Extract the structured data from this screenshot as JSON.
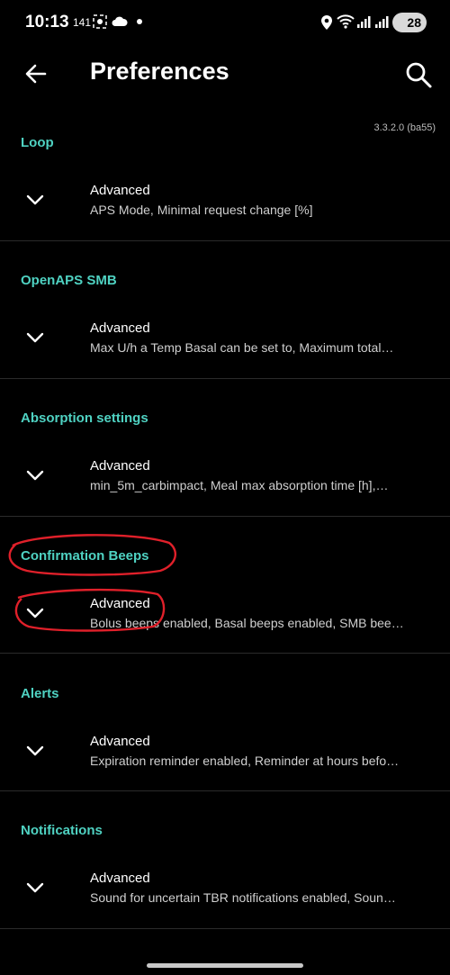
{
  "status_bar": {
    "time": "10:13",
    "small_text": "141",
    "battery": "28"
  },
  "appbar": {
    "title": "Preferences"
  },
  "version": "3.3.2.0 (ba55)",
  "sections": [
    {
      "header": "Loop",
      "item_title": "Advanced",
      "item_summary": "APS Mode, Minimal request change [%]"
    },
    {
      "header": "OpenAPS SMB",
      "item_title": "Advanced",
      "item_summary": "Max U/h a Temp Basal can be set to, Maximum total…"
    },
    {
      "header": "Absorption settings",
      "item_title": "Advanced",
      "item_summary": "min_5m_carbimpact, Meal max absorption time [h],…"
    },
    {
      "header": "Confirmation Beeps",
      "item_title": "Advanced",
      "item_summary": "Bolus beeps enabled, Basal beeps enabled, SMB bee…"
    },
    {
      "header": "Alerts",
      "item_title": "Advanced",
      "item_summary": "Expiration reminder enabled, Reminder at hours befo…"
    },
    {
      "header": "Notifications",
      "item_title": "Advanced",
      "item_summary": "Sound for uncertain TBR notifications enabled, Soun…"
    }
  ],
  "colors": {
    "accent": "#4fd2c2",
    "background": "#000000",
    "annotation": "#e0202a"
  },
  "icons": [
    "back-arrow-icon",
    "search-icon",
    "chevron-down-icon"
  ]
}
